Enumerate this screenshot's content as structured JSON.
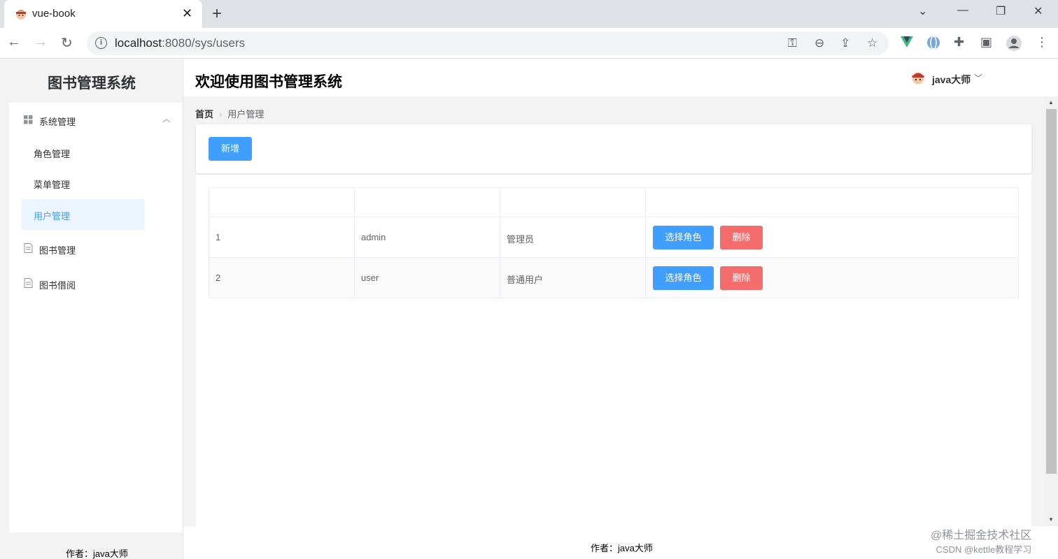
{
  "browser": {
    "tab_title": "vue-book",
    "tab_close": "✕",
    "new_tab": "+",
    "url_host": "localhost",
    "url_rest": ":8080/sys/users",
    "info": "i"
  },
  "sidebar": {
    "brand": "图书管理系统",
    "groups": [
      {
        "label": "系统管理",
        "children": [
          "角色管理",
          "菜单管理",
          "用户管理"
        ]
      },
      {
        "label": "图书管理"
      },
      {
        "label": "图书借阅"
      }
    ],
    "footer": "作者：java大师"
  },
  "header": {
    "title": "欢迎使用图书管理系统",
    "user_name": "java大师"
  },
  "breadcrumb": {
    "home": "首页",
    "current": "用户管理"
  },
  "toolbar": {
    "add_label": "新增"
  },
  "table": {
    "rows": [
      {
        "id": "1",
        "username": "admin",
        "name": "管理员",
        "role_btn": "选择角色",
        "delete_btn": "删除"
      },
      {
        "id": "2",
        "username": "user",
        "name": "普通用户",
        "role_btn": "选择角色",
        "delete_btn": "删除"
      }
    ]
  },
  "footer": "作者：java大师",
  "watermark": {
    "line1": "@稀土掘金技术社区",
    "line2": "CSDN @kettle教程学习"
  },
  "colors": {
    "primary": "#409eff",
    "danger": "#f56c6c",
    "active_bg": "#ecf5ff"
  }
}
